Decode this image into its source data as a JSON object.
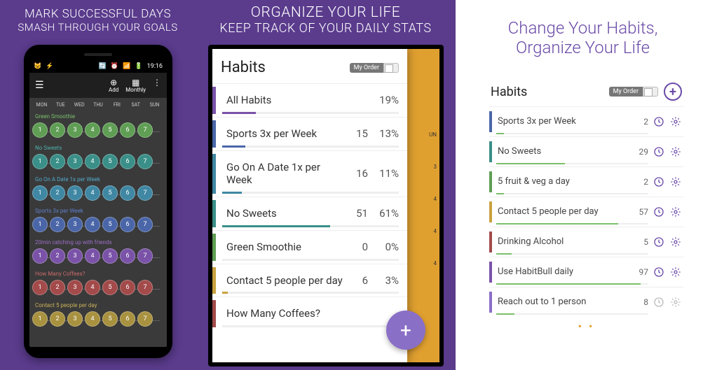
{
  "panel1": {
    "headline1": "MARK SUCCESSFUL DAYS",
    "headline2": "SMASH THROUGH YOUR GOALS",
    "status_time": "19:16",
    "action_add": "Add",
    "action_monthly": "Monthly",
    "days": [
      "MON",
      "TUE",
      "WED",
      "THU",
      "FRI",
      "SAT",
      "SUN"
    ],
    "habits": [
      {
        "name": "Green Smoothie",
        "color": "green"
      },
      {
        "name": "No Sweets",
        "color": "teal"
      },
      {
        "name": "Go On A Date 1x per Week",
        "color": "cyan"
      },
      {
        "name": "Sports 3x per Week",
        "color": "blue"
      },
      {
        "name": "20min catching up with friends",
        "color": "purple"
      },
      {
        "name": "How Many Coffees?",
        "color": "red"
      },
      {
        "name": "Contact 5 people per day",
        "color": "yellow"
      }
    ],
    "bubble_labels": [
      "1",
      "2",
      "3",
      "4",
      "5",
      "6",
      "7"
    ]
  },
  "panel2": {
    "headline1": "ORGANIZE YOUR LIFE",
    "headline2": "KEEP TRACK OF YOUR DAILY STATS",
    "title": "Habits",
    "order_label": "My Order",
    "bg_label_top": "UN",
    "bg_nums": [
      "3",
      "4",
      "4",
      "4"
    ],
    "rows": [
      {
        "name": "All Habits",
        "count": "",
        "pct": "19%",
        "color": "#7a52a8",
        "prog": 19
      },
      {
        "name": "Sports 3x per Week",
        "count": "15",
        "pct": "13%",
        "color": "#4a66a8",
        "prog": 13
      },
      {
        "name": "Go On A Date 1x per Week",
        "count": "16",
        "pct": "11%",
        "color": "#3f87a3",
        "prog": 11
      },
      {
        "name": "No Sweets",
        "count": "51",
        "pct": "61%",
        "color": "#3a8f88",
        "prog": 61
      },
      {
        "name": "Green Smoothie",
        "count": "0",
        "pct": "0%",
        "color": "#5f9e54",
        "prog": 0
      },
      {
        "name": "Contact 5 people per day",
        "count": "6",
        "pct": "3%",
        "color": "#c9a23f",
        "prog": 3
      },
      {
        "name": "How Many Coffees?",
        "count": "",
        "pct": "",
        "color": "#a34a4a",
        "prog": 0
      }
    ]
  },
  "panel3": {
    "headline1": "Change Your Habits,",
    "headline2": "Organize Your Life",
    "title": "Habits",
    "order_label": "My Order",
    "rows": [
      {
        "name": "Sports 3x per Week",
        "count": "2",
        "color": "#4a66a8",
        "active": true,
        "prog": 5
      },
      {
        "name": "No Sweets",
        "count": "29",
        "color": "#3a8f88",
        "active": true,
        "prog": 45
      },
      {
        "name": "5 fruit & veg a day",
        "count": "2",
        "color": "#5f9e54",
        "active": true,
        "prog": 5
      },
      {
        "name": "Contact 5 people per day",
        "count": "57",
        "color": "#c9a23f",
        "active": true,
        "prog": 80
      },
      {
        "name": "Drinking Alcohol",
        "count": "5",
        "color": "#a34a4a",
        "active": true,
        "prog": 10
      },
      {
        "name": "Use HabitBull daily",
        "count": "97",
        "color": "#7a52a8",
        "active": true,
        "prog": 95
      },
      {
        "name": "Reach out to 1 person",
        "count": "8",
        "color": "#8a6fc7",
        "active": false,
        "prog": 12
      }
    ]
  }
}
